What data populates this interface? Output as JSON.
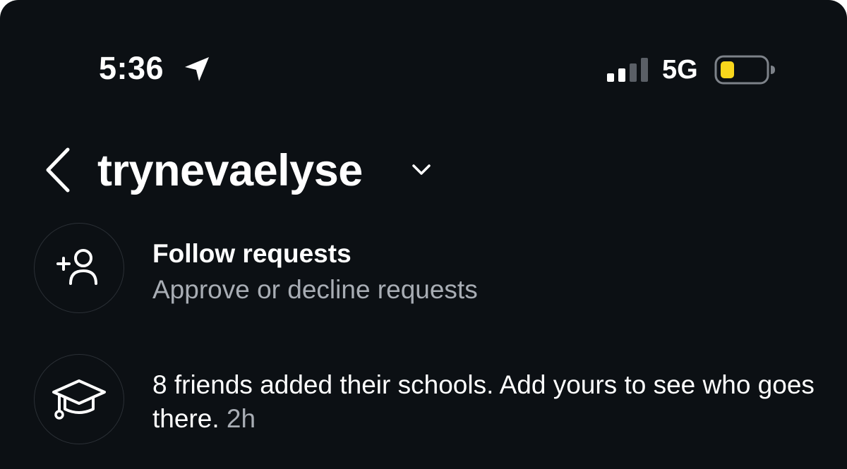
{
  "status_bar": {
    "time": "5:36",
    "network": "5G",
    "icons": [
      "location-arrow-icon",
      "cellular-signal-icon",
      "battery-icon"
    ],
    "battery_color": "#f9d71c"
  },
  "header": {
    "username": "trynevaelyse",
    "back_icon": "chevron-left-icon",
    "dropdown_icon": "chevron-down-icon"
  },
  "notifications": {
    "follow_requests": {
      "title": "Follow requests",
      "subtitle": "Approve or decline requests",
      "icon": "add-person-icon"
    },
    "schools": {
      "text": "8 friends added their schools. Add yours to see who goes there.",
      "time": "2h",
      "icon": "graduation-cap-icon"
    }
  },
  "colors": {
    "background": "#0c1014",
    "primary_text": "#ffffff",
    "secondary_text": "#a8adb4",
    "divider": "#2b3036"
  }
}
